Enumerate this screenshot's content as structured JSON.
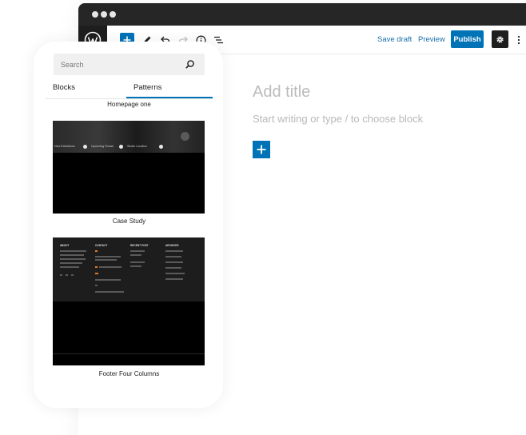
{
  "toolbar": {
    "save_draft_label": "Save draft",
    "preview_label": "Preview",
    "publish_label": "Publish"
  },
  "editor": {
    "title_placeholder": "Add title",
    "body_placeholder": "Start writing or type / to choose block"
  },
  "inserter": {
    "search_placeholder": "Search",
    "tabs": [
      "Blocks",
      "Patterns"
    ],
    "active_tab": "Patterns",
    "patterns": [
      {
        "label": "Homepage one"
      },
      {
        "label": "Case Study"
      },
      {
        "label": "Footer Four Columns"
      }
    ]
  },
  "colors": {
    "accent": "#0073b7",
    "chrome": "#262626",
    "dark": "#1e1e1e"
  }
}
